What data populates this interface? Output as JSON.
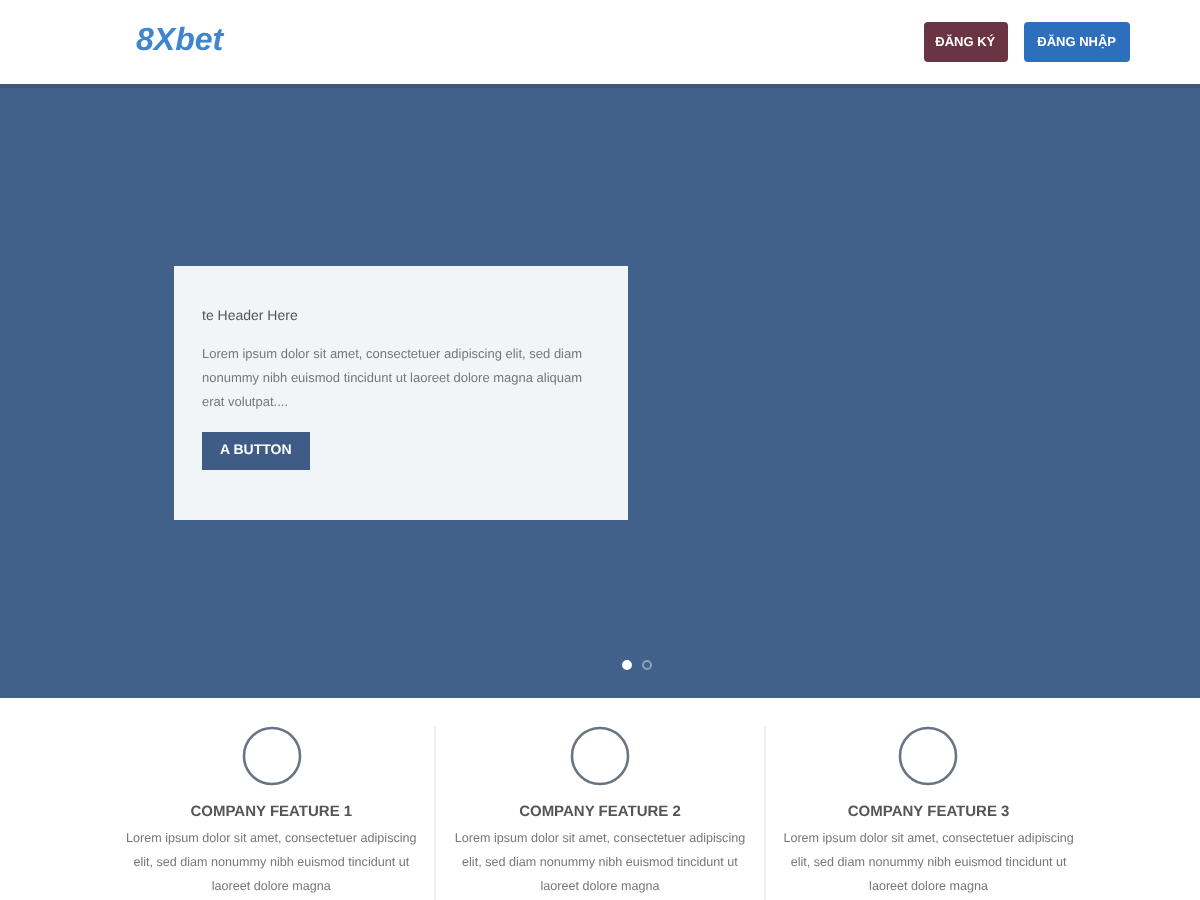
{
  "header": {
    "logo": "8Xbet",
    "buttons": [
      {
        "label": "ĐĂNG KÝ",
        "kind": "register"
      },
      {
        "label": "ĐĂNG NHẬP",
        "kind": "login"
      }
    ]
  },
  "hero": {
    "card": {
      "title": "te Header Here",
      "text": "Lorem ipsum dolor sit amet, consectetuer adipiscing elit, sed diam nonummy nibh euismod tincidunt ut laoreet dolore magna aliquam erat volutpat....",
      "button": "A BUTTON"
    },
    "dots": [
      {
        "selected": true
      },
      {
        "selected": false
      }
    ]
  },
  "features": [
    {
      "title": "COMPANY FEATURE 1",
      "text": "Lorem ipsum dolor sit amet, consectetuer adipiscing elit, sed diam nonummy nibh euismod tincidunt ut laoreet dolore magna"
    },
    {
      "title": "COMPANY FEATURE 2",
      "text": "Lorem ipsum dolor sit amet, consectetuer adipiscing elit, sed diam nonummy nibh euismod tincidunt ut laoreet dolore magna"
    },
    {
      "title": "COMPANY FEATURE 3",
      "text": "Lorem ipsum dolor sit amet, consectetuer adipiscing elit, sed diam nonummy nibh euismod tincidunt ut laoreet dolore magna"
    }
  ]
}
